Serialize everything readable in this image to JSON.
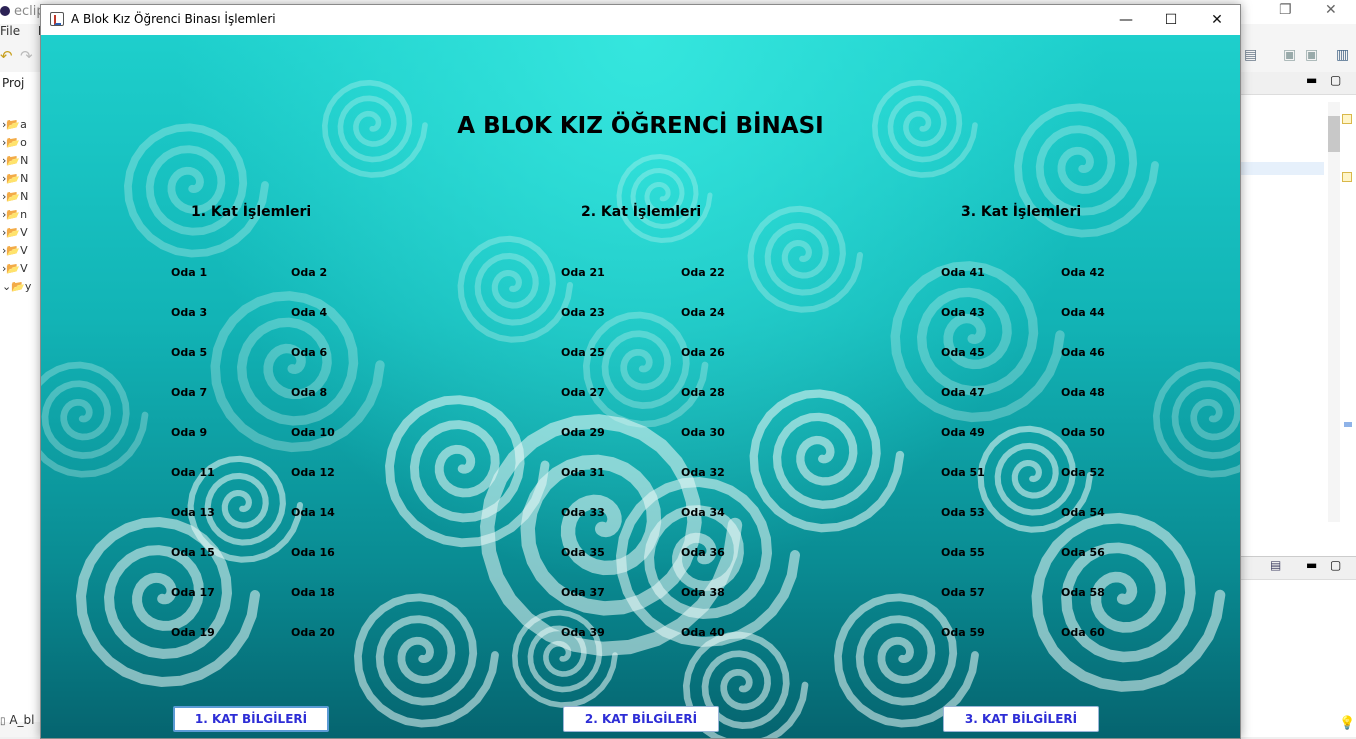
{
  "eclipse": {
    "title": "eclip",
    "menu": [
      "File",
      "Ed"
    ],
    "project_tab": "Proj",
    "tree_items": [
      "a",
      "o",
      "N",
      "N",
      "N",
      "n",
      "V",
      "V",
      "V",
      "y"
    ],
    "status_file": "A_bl"
  },
  "window": {
    "title": "A Blok Kız Öğrenci Binası İşlemleri",
    "minimize_glyph": "—",
    "maximize_glyph": "☐",
    "close_glyph": "✕"
  },
  "main": {
    "heading": "A BLOK KIZ ÖĞRENCİ BİNASI",
    "floors": [
      {
        "title": "1. Kat İşlemleri",
        "button": "1. KAT BİLGİLERİ",
        "rooms": [
          "Oda 1",
          "Oda 2",
          "Oda 3",
          "Oda 4",
          "Oda 5",
          "Oda 6",
          "Oda 7",
          "Oda 8",
          "Oda 9",
          "Oda 10",
          "Oda 11",
          "Oda 12",
          "Oda 13",
          "Oda 14",
          "Oda 15",
          "Oda 16",
          "Oda 17",
          "Oda 18",
          "Oda 19",
          "Oda 20"
        ]
      },
      {
        "title": "2. Kat İşlemleri",
        "button": "2. KAT BİLGİLERİ",
        "rooms": [
          "Oda 21",
          "Oda 22",
          "Oda 23",
          "Oda 24",
          "Oda 25",
          "Oda 26",
          "Oda 27",
          "Oda 28",
          "Oda 29",
          "Oda 30",
          "Oda 31",
          "Oda 32",
          "Oda 33",
          "Oda 34",
          "Oda 35",
          "Oda 36",
          "Oda 37",
          "Oda 38",
          "Oda 39",
          "Oda 40"
        ]
      },
      {
        "title": "3. Kat İşlemleri",
        "button": "3. KAT BİLGİLERİ",
        "rooms": [
          "Oda 41",
          "Oda 42",
          "Oda 43",
          "Oda 44",
          "Oda 45",
          "Oda 46",
          "Oda 47",
          "Oda 48",
          "Oda 49",
          "Oda 50",
          "Oda 51",
          "Oda 52",
          "Oda 53",
          "Oda 54",
          "Oda 55",
          "Oda 56",
          "Oda 57",
          "Oda 58",
          "Oda 59",
          "Oda 60"
        ]
      }
    ]
  },
  "colors": {
    "button_text": "#2d2dd6",
    "bg_top": "#1ecfcc",
    "bg_bottom": "#05646f"
  }
}
